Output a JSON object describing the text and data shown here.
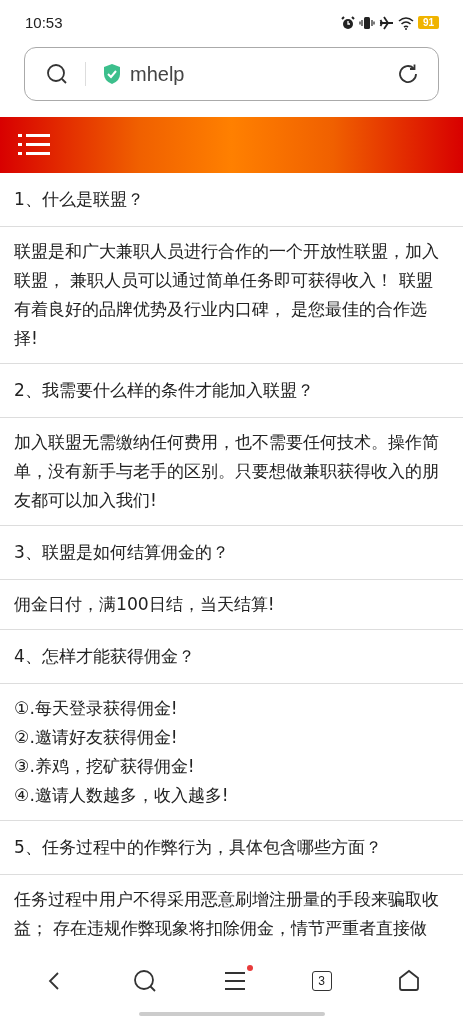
{
  "status_bar": {
    "time": "10:53",
    "battery": "91"
  },
  "address_bar": {
    "url": "mhelp",
    "secure": true
  },
  "faq": [
    {
      "question": "1、什么是联盟？",
      "answer": [
        "联盟是和广大兼职人员进行合作的一个开放性联盟，加入联盟， 兼职人员可以通过简单任务即可获得收入！ 联盟有着良好的品牌优势及行业内口碑， 是您最佳的合作选择!"
      ]
    },
    {
      "question": "2、我需要什么样的条件才能加入联盟？",
      "answer": [
        "加入联盟无需缴纳任何费用，也不需要任何技术。操作简单，没有新手与老手的区别。只要想做兼职获得收入的朋友都可以加入我们!"
      ]
    },
    {
      "question": "3、联盟是如何结算佣金的？",
      "answer": [
        "佣金日付，满100日结，当天结算!"
      ]
    },
    {
      "question": "4、怎样才能获得佣金？",
      "answer": [
        "①.每天登录获得佣金!",
        "②.邀请好友获得佣金!",
        "③.养鸡，挖矿获得佣金!",
        "④.邀请人数越多，收入越多!"
      ]
    },
    {
      "question": "5、任务过程中的作弊行为，具体包含哪些方面？",
      "answer": [
        "任务过程中用户不得采用恶意刷增注册量的手段来骗取收益； 存在违规作弊现象将扣除佣金，情节严重者直接做"
      ]
    }
  ],
  "bottom_nav": {
    "tab_count": "3",
    "menu_badge": true
  }
}
